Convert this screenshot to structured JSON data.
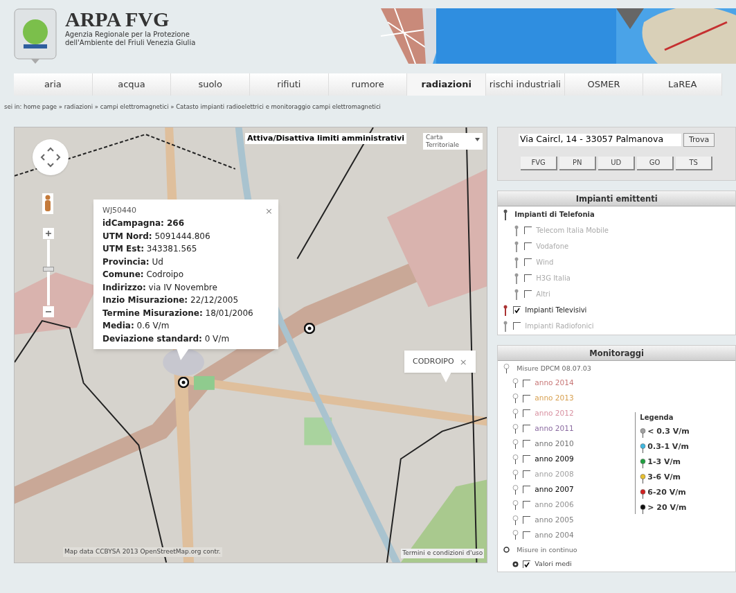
{
  "header": {
    "title": "ARPA FVG",
    "subtitle_lines": [
      "Agenzia Regionale per la Protezione",
      "dell'Ambiente del Friuli Venezia Giulia"
    ]
  },
  "nav": [
    {
      "label": "aria",
      "selected": false
    },
    {
      "label": "acqua",
      "selected": false
    },
    {
      "label": "suolo",
      "selected": false
    },
    {
      "label": "rifiuti",
      "selected": false
    },
    {
      "label": "rumore",
      "selected": false
    },
    {
      "label": "radiazioni",
      "selected": true
    },
    {
      "label": "rischi industriali",
      "selected": false
    },
    {
      "label": "OSMER",
      "selected": false
    },
    {
      "label": "LaREA",
      "selected": false
    }
  ],
  "breadcrumb": "sei in: home page » radiazioni » campi elettromagnetici » Catasto impianti radioelettrici e monitoraggio campi elettromagnetici",
  "map": {
    "toggle_button": "Attiva/Disattiva limiti amministrativi",
    "map_type": "Carta Territoriale",
    "zoom": {
      "level": 0.55
    },
    "popup": {
      "code": "WJ50440",
      "close": "×",
      "fields": [
        "**idCampagna: 266**",
        "**UTM Nord:** 5091444.806",
        "**UTM Est:** 343381.565",
        "**Provincia:** Ud",
        "**Comune:** Codroipo",
        "**Indirizzo:** via IV Novembre",
        "**Inzio Misurazione:** 22/12/2005",
        "**Termine Misurazione:** 18/01/2006",
        "**Media:** 0.6 V/m",
        "**Deviazione standard:** 0 V/m"
      ]
    },
    "label_popup": {
      "text": "CODROIPO",
      "close": "×"
    },
    "attribution": "Map data CCBYSA 2013 OpenStreetMap.org contr.",
    "terms": "Termini e condizioni d'uso"
  },
  "search": {
    "value": "Via Caircl, 14 - 33057 Palmanova",
    "button": "Trova",
    "areas": [
      "FVG",
      "PN",
      "UD",
      "GO",
      "TS"
    ]
  },
  "emitters": {
    "title": "Impianti emittenti",
    "group": "Impianti di Telefonia",
    "items": [
      {
        "label": "Telecom Italia Mobile",
        "checked": false,
        "disabled": true,
        "kind": "child"
      },
      {
        "label": "Vodafone",
        "checked": false,
        "disabled": true,
        "kind": "child"
      },
      {
        "label": "Wind",
        "checked": false,
        "disabled": true,
        "kind": "child"
      },
      {
        "label": "H3G Italia",
        "checked": false,
        "disabled": true,
        "kind": "child"
      },
      {
        "label": "Altri",
        "checked": false,
        "disabled": true,
        "kind": "child"
      },
      {
        "label": "Impianti Televisivi",
        "checked": true,
        "disabled": false,
        "kind": "top"
      },
      {
        "label": "Impianti Radiofonici",
        "checked": false,
        "disabled": true,
        "kind": "top"
      }
    ]
  },
  "monitoring": {
    "title": "Monitoraggi",
    "group": "Misure DPCM 08.07.03",
    "years": [
      {
        "label": "anno 2014",
        "checked": false,
        "color": "#c87878"
      },
      {
        "label": "anno 2013",
        "checked": false,
        "color": "#d8a050"
      },
      {
        "label": "anno 2012",
        "checked": false,
        "color": "#d890a0"
      },
      {
        "label": "anno 2011",
        "checked": false,
        "color": "#8a6aa0"
      },
      {
        "label": "anno 2010",
        "checked": false,
        "color": "#707070"
      },
      {
        "label": "anno 2009",
        "checked": false,
        "color": "#000000"
      },
      {
        "label": "anno 2008",
        "checked": false,
        "color": "#a0a0a0"
      },
      {
        "label": "anno 2007",
        "checked": false,
        "color": "#000000"
      },
      {
        "label": "anno 2006",
        "checked": false,
        "color": "#909090"
      },
      {
        "label": "anno 2005",
        "checked": false,
        "color": "#808080"
      },
      {
        "label": "anno 2004",
        "checked": false,
        "color": "#808080"
      }
    ],
    "continuous": "Misure in continuo",
    "continuous_items": [
      {
        "label": "Valori medi",
        "checked": true
      }
    ],
    "legend": {
      "title": "Legenda",
      "items": [
        {
          "label": "< 0.3 V/m",
          "color": "#a0a0a0"
        },
        {
          "label": "0.3-1 V/m",
          "color": "#40b8e0"
        },
        {
          "label": "1-3 V/m",
          "color": "#20a040"
        },
        {
          "label": "3-6 V/m",
          "color": "#e8c030"
        },
        {
          "label": "6-20 V/m",
          "color": "#d02020"
        },
        {
          "label": "> 20 V/m",
          "color": "#101010"
        }
      ]
    }
  }
}
